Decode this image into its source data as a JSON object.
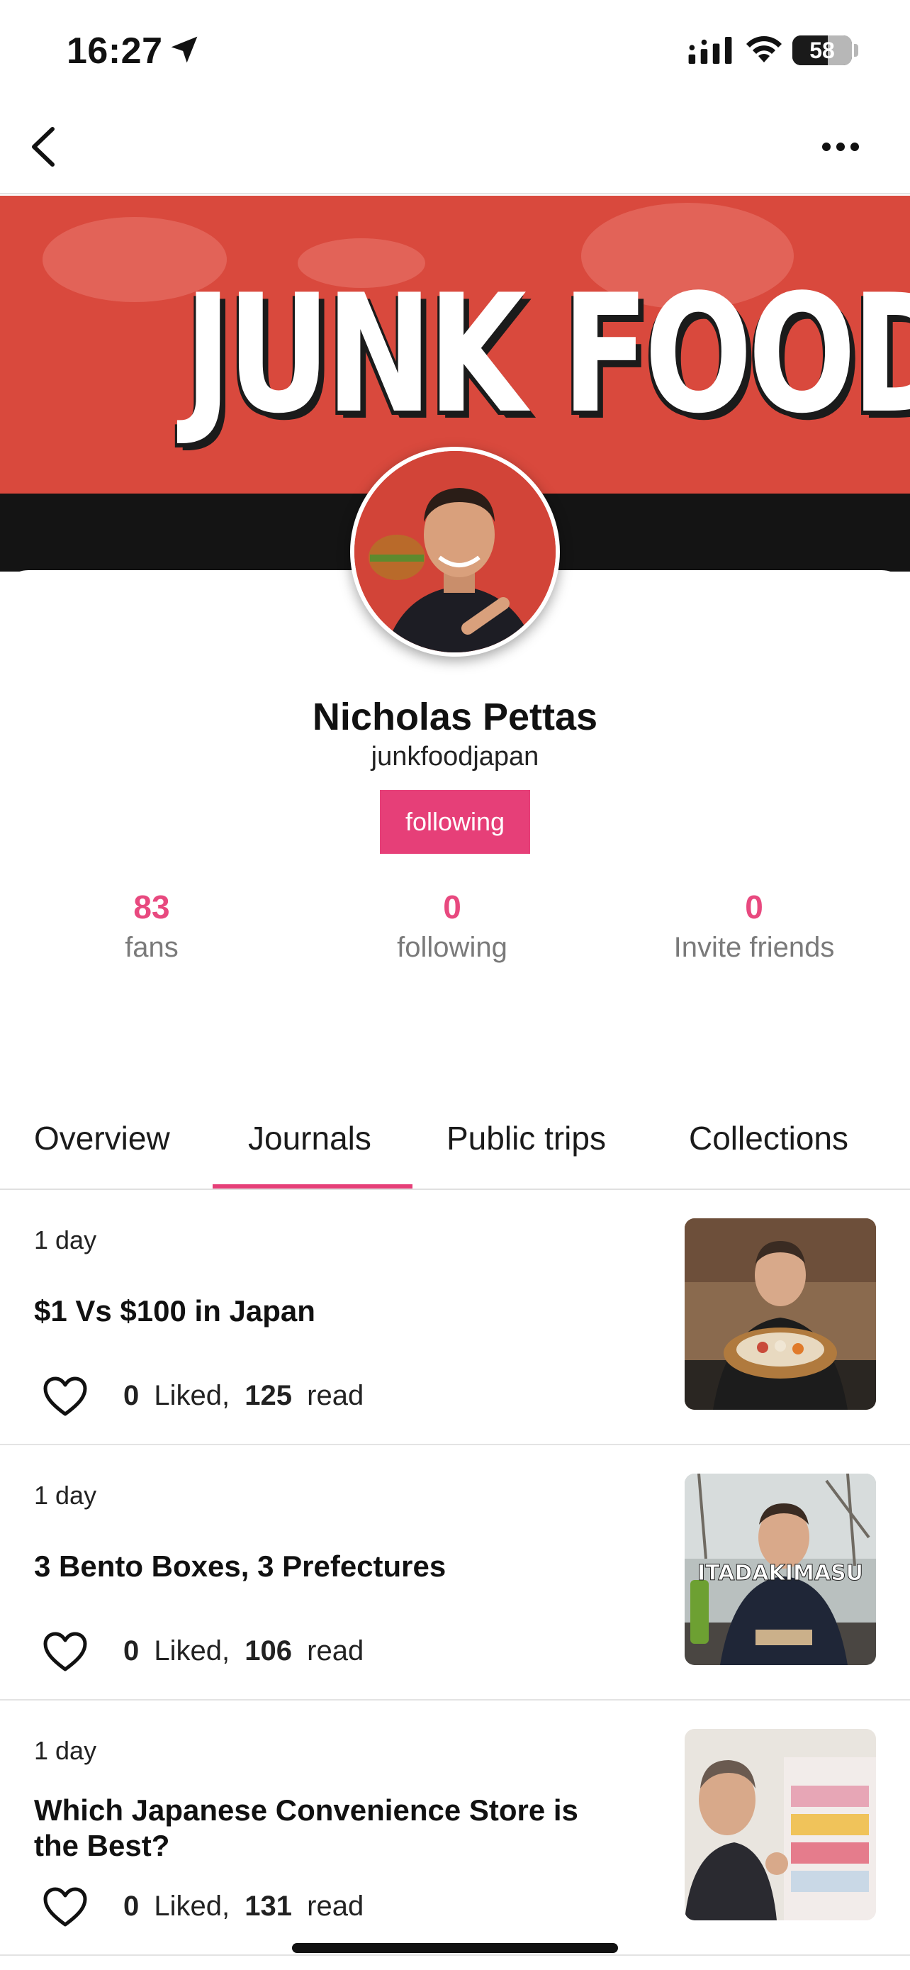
{
  "status_bar": {
    "time": "16:27",
    "battery": "58"
  },
  "cover": {
    "text": "JUNK FOOD"
  },
  "profile": {
    "name": "Nicholas Pettas",
    "handle": "junkfoodjapan",
    "follow_label": "following"
  },
  "stats": [
    {
      "number": "83",
      "label": "fans"
    },
    {
      "number": "0",
      "label": "following"
    },
    {
      "number": "0",
      "label": "Invite friends"
    }
  ],
  "tabs": [
    {
      "label": "Overview",
      "active": false
    },
    {
      "label": "Journals",
      "active": true
    },
    {
      "label": "Public trips",
      "active": false
    },
    {
      "label": "Collections",
      "active": false
    }
  ],
  "journals": [
    {
      "ago": "1 day",
      "title": "$1 Vs $100 in Japan",
      "liked": "0",
      "liked_label": "Liked,",
      "read": "125",
      "read_label": "read"
    },
    {
      "ago": "1 day",
      "title": "3 Bento Boxes, 3 Prefectures",
      "liked": "0",
      "liked_label": "Liked,",
      "read": "106",
      "read_label": "read",
      "thumb_text": "ITADAKIMASU"
    },
    {
      "ago": "1 day",
      "title": "Which Japanese Convenience Store is the Best?",
      "liked": "0",
      "liked_label": "Liked,",
      "read": "131",
      "read_label": "read"
    }
  ],
  "colors": {
    "accent": "#e63f78",
    "stat_number": "#e8497f",
    "cover_red": "#d9493d"
  },
  "icons": [
    "location-arrow-icon",
    "signal-icon",
    "wifi-icon",
    "battery-icon",
    "back-chevron-icon",
    "more-icon",
    "heart-icon"
  ]
}
